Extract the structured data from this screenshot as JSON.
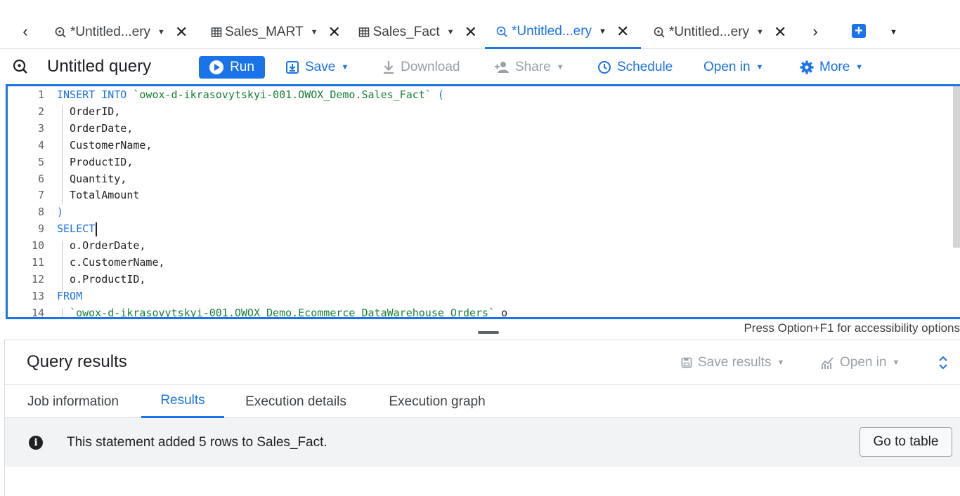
{
  "tabs": [
    {
      "label": "*Untitled...ery",
      "icon": "query-icon",
      "active": false
    },
    {
      "label": "Sales_MART",
      "icon": "table-icon",
      "active": false
    },
    {
      "label": "Sales_Fact",
      "icon": "table-icon",
      "active": false
    },
    {
      "label": "*Untitled...ery",
      "icon": "query-icon",
      "active": true
    },
    {
      "label": "*Untitled...ery",
      "icon": "query-icon",
      "active": false
    }
  ],
  "toolbar": {
    "title": "Untitled query",
    "run": "Run",
    "save": "Save",
    "download": "Download",
    "share": "Share",
    "schedule": "Schedule",
    "open_in": "Open in",
    "more": "More"
  },
  "editor": {
    "lines": [
      {
        "n": "1",
        "parts": [
          [
            "kw",
            "INSERT INTO "
          ],
          [
            "str",
            "`owox-d-ikrasovytskyi-001.OWOX_Demo.Sales_Fact`"
          ],
          [
            "kw",
            " ("
          ]
        ]
      },
      {
        "n": "2",
        "parts": [
          [
            "txt",
            "  OrderID,"
          ]
        ]
      },
      {
        "n": "3",
        "parts": [
          [
            "txt",
            "  OrderDate,"
          ]
        ]
      },
      {
        "n": "4",
        "parts": [
          [
            "txt",
            "  CustomerName,"
          ]
        ]
      },
      {
        "n": "5",
        "parts": [
          [
            "txt",
            "  ProductID,"
          ]
        ]
      },
      {
        "n": "6",
        "parts": [
          [
            "txt",
            "  Quantity,"
          ]
        ]
      },
      {
        "n": "7",
        "parts": [
          [
            "txt",
            "  TotalAmount"
          ]
        ]
      },
      {
        "n": "8",
        "parts": [
          [
            "kw",
            ")"
          ]
        ]
      },
      {
        "n": "9",
        "parts": [
          [
            "kw",
            "SELECT"
          ]
        ]
      },
      {
        "n": "10",
        "parts": [
          [
            "txt",
            "  o.OrderDate,"
          ]
        ]
      },
      {
        "n": "11",
        "parts": [
          [
            "txt",
            "  c.CustomerName,"
          ]
        ]
      },
      {
        "n": "12",
        "parts": [
          [
            "txt",
            "  o.ProductID,"
          ]
        ]
      },
      {
        "n": "13",
        "parts": [
          [
            "kw",
            "FROM"
          ]
        ]
      },
      {
        "n": "14",
        "parts": [
          [
            "txt",
            "  "
          ],
          [
            "str",
            "`owox-d-ikrasovytskyi-001.OWOX_Demo.Ecommerce_DataWarehouse_Orders`"
          ],
          [
            "txt",
            " o"
          ]
        ]
      }
    ],
    "accessibility_hint": "Press Option+F1 for accessibility options"
  },
  "results": {
    "title": "Query results",
    "save_results": "Save results",
    "open_in": "Open in",
    "tabs": [
      "Job information",
      "Results",
      "Execution details",
      "Execution graph"
    ],
    "active_tab": "Results",
    "message": "This statement added 5 rows to Sales_Fact.",
    "go_to_table": "Go to table"
  },
  "colors": {
    "accent": "#1a73e8",
    "keyword": "#1a73e8",
    "string": "#188038",
    "disabled": "#9aa0a6"
  }
}
